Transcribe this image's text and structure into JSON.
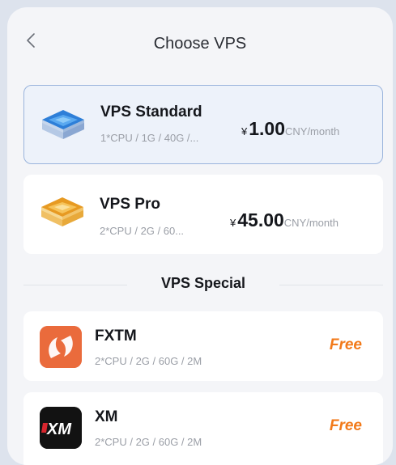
{
  "header": {
    "title": "Choose VPS"
  },
  "plans": [
    {
      "name": "VPS Standard",
      "spec": "1*CPU / 1G / 40G /...",
      "currency": "¥",
      "price": "1.00",
      "unit": "CNY/month",
      "selected": true,
      "icon": "server-blue-icon"
    },
    {
      "name": "VPS Pro",
      "spec": "2*CPU / 2G / 60...",
      "currency": "¥",
      "price": "45.00",
      "unit": "CNY/month",
      "selected": false,
      "icon": "server-gold-icon"
    }
  ],
  "special": {
    "heading": "VPS Special",
    "items": [
      {
        "name": "FXTM",
        "spec": "2*CPU / 2G / 60G / 2M",
        "price_label": "Free",
        "icon": "fxtm-logo"
      },
      {
        "name": "XM",
        "spec": "2*CPU / 2G / 60G / 2M",
        "price_label": "Free",
        "icon": "xm-logo"
      }
    ]
  },
  "colors": {
    "accent_orange": "#f27a1a",
    "selected_border": "#9ab4dc",
    "selected_bg": "#edf2fa"
  }
}
